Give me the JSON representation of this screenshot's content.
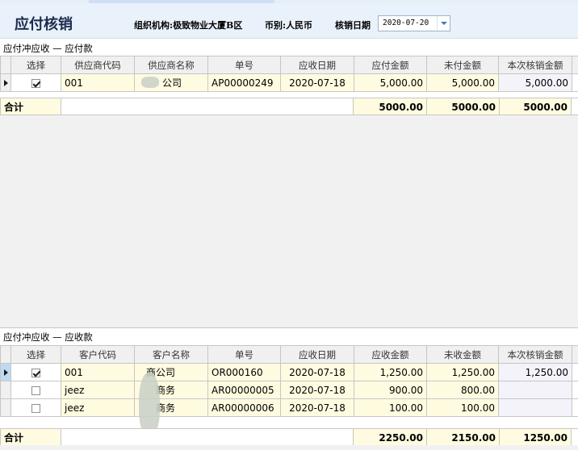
{
  "header": {
    "title": "应付核销",
    "org_label": "组织机构:",
    "org_value": "极致物业大厦B区",
    "currency_label": "币别:",
    "currency_value": "人民币",
    "date_label": "核销日期",
    "date_value": "2020-07-20"
  },
  "payable_section": {
    "label": "应付冲应收 — 应付款",
    "columns": [
      "选择",
      "供应商代码",
      "供应商名称",
      "单号",
      "应收日期",
      "应付金额",
      "未付金额",
      "本次核销金额"
    ],
    "rows": [
      {
        "selected": true,
        "code": "001",
        "name": "公司",
        "number": "AP00000249",
        "date": "2020-07-18",
        "amount": "5,000.00",
        "unpaid": "5,000.00",
        "writeoff": "5,000.00"
      }
    ],
    "total_label": "合计",
    "totals": {
      "amount": "5000.00",
      "unpaid": "5000.00",
      "writeoff": "5000.00"
    }
  },
  "receivable_section": {
    "label": "应付冲应收 — 应收款",
    "columns": [
      "选择",
      "客户代码",
      "客户名称",
      "单号",
      "应收日期",
      "应收金额",
      "未收金额",
      "本次核销金额"
    ],
    "rows": [
      {
        "selected": true,
        "code": "001",
        "name": "商公司",
        "number": "OR000160",
        "date": "2020-07-18",
        "amount": "1,250.00",
        "unreceived": "1,250.00",
        "writeoff": "1,250.00"
      },
      {
        "selected": false,
        "code": "jeez",
        "name": "商务",
        "number": "AR00000005",
        "date": "2020-07-18",
        "amount": "900.00",
        "unreceived": "800.00",
        "writeoff": ""
      },
      {
        "selected": false,
        "code": "jeez",
        "name": "商务",
        "number": "AR00000006",
        "date": "2020-07-18",
        "amount": "100.00",
        "unreceived": "100.00",
        "writeoff": ""
      }
    ],
    "total_label": "合计",
    "totals": {
      "amount": "2250.00",
      "unreceived": "2150.00",
      "writeoff": "1250.00"
    }
  }
}
